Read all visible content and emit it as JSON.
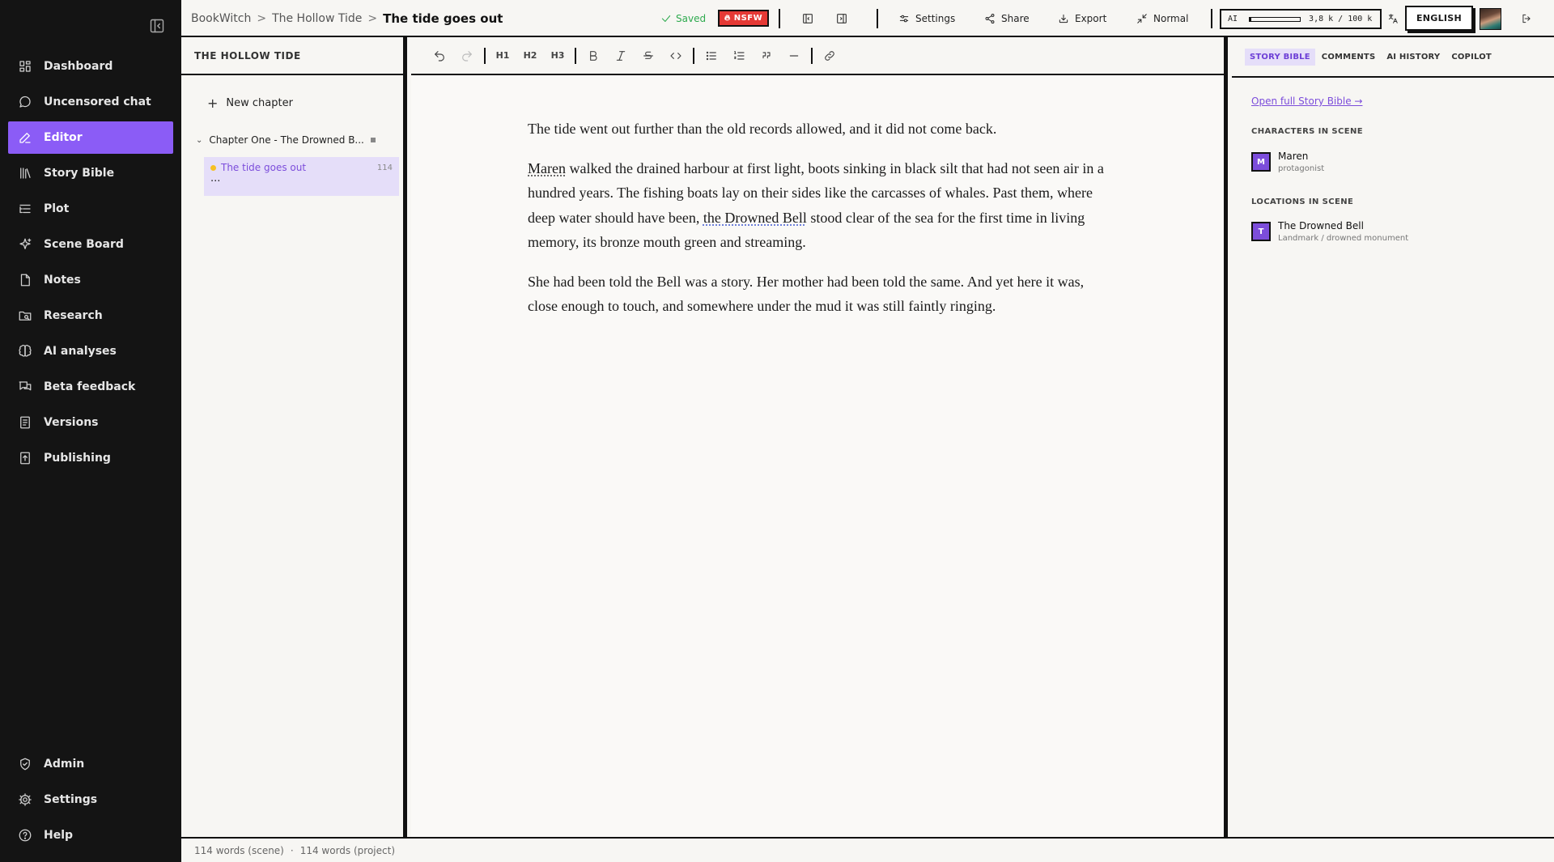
{
  "app": {
    "accent_color": "#8b5cf6",
    "nav": {
      "items": [
        {
          "id": "dashboard",
          "label": "Dashboard",
          "icon": "grid-icon"
        },
        {
          "id": "uncensored-chat",
          "label": "Uncensored chat",
          "icon": "chat-bubble-icon"
        },
        {
          "id": "editor",
          "label": "Editor",
          "icon": "pencil-icon",
          "active": true
        },
        {
          "id": "story-bible",
          "label": "Story Bible",
          "icon": "library-icon"
        },
        {
          "id": "plot",
          "label": "Plot",
          "icon": "list-tree-icon"
        },
        {
          "id": "scene-board",
          "label": "Scene Board",
          "icon": "sparkle-icon"
        },
        {
          "id": "notes",
          "label": "Notes",
          "icon": "note-icon"
        },
        {
          "id": "research",
          "label": "Research",
          "icon": "folder-search-icon"
        },
        {
          "id": "ai-analyses",
          "label": "AI analyses",
          "icon": "brain-icon"
        },
        {
          "id": "beta-feedback",
          "label": "Beta feedback",
          "icon": "messages-icon"
        },
        {
          "id": "versions",
          "label": "Versions",
          "icon": "document-lines-icon"
        },
        {
          "id": "publishing",
          "label": "Publishing",
          "icon": "upload-book-icon"
        }
      ],
      "bottom": [
        {
          "id": "admin",
          "label": "Admin",
          "icon": "shield-check-icon"
        },
        {
          "id": "settings",
          "label": "Settings",
          "icon": "gear-icon"
        },
        {
          "id": "help",
          "label": "Help",
          "icon": "help-circle-icon"
        }
      ]
    }
  },
  "topbar": {
    "breadcrumb": [
      "BookWitch",
      "The Hollow Tide"
    ],
    "breadcrumb_current": "The tide goes out",
    "breadcrumb_separator": ">",
    "saved_label": "Saved",
    "nsfw_label": "NSFW",
    "settings_label": "Settings",
    "share_label": "Share",
    "export_label": "Export",
    "mode_label": "Normal",
    "ai_label": "AI",
    "ai_usage_text": "3,8 k / 100 k",
    "ai_usage_fraction": 0.038,
    "language_label": "ENGLISH",
    "nsfw_color": "#e53935",
    "saved_color": "#2eaa4e"
  },
  "outline": {
    "title": "THE HOLLOW TIDE",
    "new_chapter_label": "New chapter",
    "chapters": [
      {
        "title": "Chapter One - The Drowned B...",
        "scenes": [
          {
            "title": "The tide goes out",
            "word_count": "114",
            "extra": "...",
            "status_color": "#f6c023"
          }
        ]
      }
    ]
  },
  "editor": {
    "paragraphs": [
      [
        {
          "text": "The tide went out further than the old records allowed, and it did not come back."
        }
      ],
      [
        {
          "text": "Maren",
          "entity": "character"
        },
        {
          "text": " walked the drained harbour at first light, boots sinking in black silt that had not seen air in a hundred years. The fishing boats lay on their sides like the carcasses of whales. Past them, where deep water should have been, "
        },
        {
          "text": "the Drowned Bell",
          "entity": "location"
        },
        {
          "text": " stood clear of the sea for the first time in living memory, its bronze mouth green and streaming."
        }
      ],
      [
        {
          "text": "She had been told the Bell was a story. Her mother had been told the same. And yet here it was, close enough to touch, and somewhere under the mud it was still faintly ringing."
        }
      ]
    ]
  },
  "right_panel": {
    "tabs": [
      "STORY BIBLE",
      "COMMENTS",
      "AI HISTORY",
      "COPILOT"
    ],
    "active_tab": 0,
    "open_bible_link": "Open full Story Bible →",
    "characters_heading": "CHARACTERS IN SCENE",
    "characters": [
      {
        "initial": "M",
        "name": "Maren",
        "role": "protagonist"
      }
    ],
    "locations_heading": "LOCATIONS IN SCENE",
    "locations": [
      {
        "initial": "T",
        "name": "The Drowned Bell",
        "type": "Landmark / drowned monument"
      }
    ]
  },
  "status": {
    "scene_words": "114 words (scene)",
    "separator": "·",
    "project_words": "114 words (project)"
  }
}
